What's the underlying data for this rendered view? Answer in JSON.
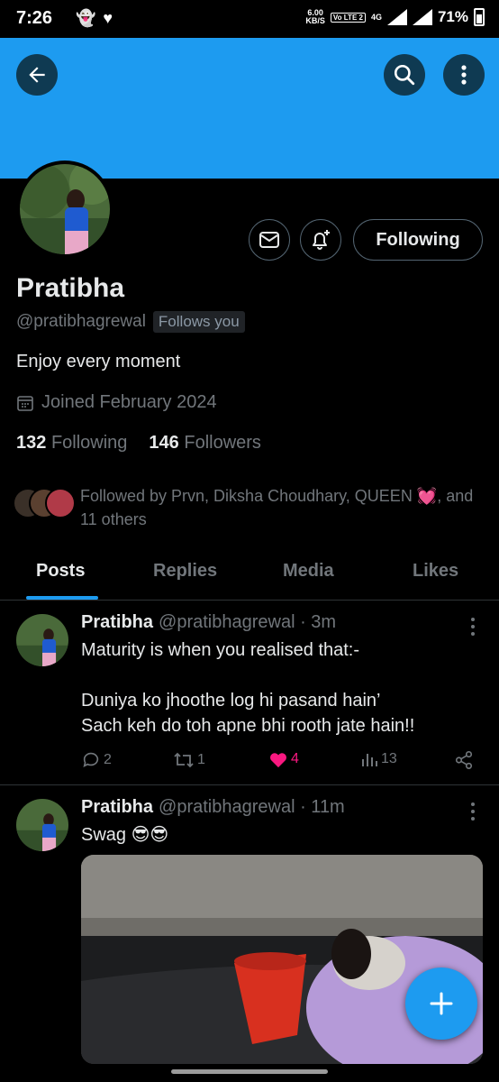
{
  "status_bar": {
    "time": "7:26",
    "net_speed_value": "6.00",
    "net_speed_unit": "KB/S",
    "volte_label": "Vo LTE 2",
    "network": "4G",
    "battery": "71%"
  },
  "profile": {
    "name": "Pratibha",
    "handle": "@pratibhagrewal",
    "follows_you": "Follows you",
    "bio": "Enjoy every moment",
    "joined": "Joined February 2024",
    "following_count": "132",
    "following_label": "Following",
    "followers_count": "146",
    "followers_label": "Followers",
    "followed_by": "Followed by Prvn, Diksha Choudhary, QUEEN 💓, and 11 others",
    "following_button": "Following"
  },
  "tabs": [
    {
      "label": "Posts"
    },
    {
      "label": "Replies"
    },
    {
      "label": "Media"
    },
    {
      "label": "Likes"
    }
  ],
  "posts": [
    {
      "name": "Pratibha",
      "meta": "@pratibhagrewal · 3m",
      "text": "Maturity is when you realised that:-\n\nDuniya ko jhoothe log hi pasand hain’\nSach keh do toh apne bhi rooth jate hain!!",
      "replies": "2",
      "reposts": "1",
      "likes": "4",
      "views": "13"
    },
    {
      "name": "Pratibha",
      "meta": "@pratibhagrewal · 11m",
      "text": "Swag 😎😎"
    }
  ],
  "colors": {
    "accent": "#1d9bf0",
    "like": "#f91880",
    "muted": "#71767b",
    "background": "#000000"
  },
  "icons": [
    "back-arrow-icon",
    "search-icon",
    "more-vertical-icon",
    "mail-icon",
    "bell-plus-icon",
    "calendar-icon",
    "reply-icon",
    "repost-icon",
    "heart-icon",
    "views-icon",
    "share-icon",
    "plus-icon"
  ]
}
